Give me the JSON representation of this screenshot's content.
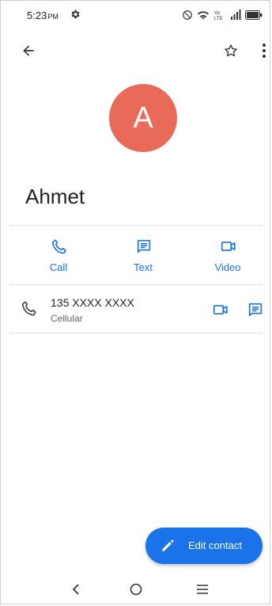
{
  "status_bar": {
    "time": "5:23",
    "ampm": "PM",
    "icons": [
      "settings-icon",
      "nfc-icon",
      "wifi-icon",
      "volte-icon",
      "signal-icon",
      "battery-icon"
    ]
  },
  "app_bar": {
    "back_icon": "arrow-left-icon",
    "favorite_icon": "star-outline-icon",
    "more_icon": "more-vert-icon"
  },
  "contact": {
    "avatar_letter": "A",
    "avatar_color": "#ea6a5a",
    "name": "Ahmet"
  },
  "actions": [
    {
      "label": "Call",
      "icon": "phone-icon"
    },
    {
      "label": "Text",
      "icon": "message-icon"
    },
    {
      "label": "Video",
      "icon": "video-icon"
    }
  ],
  "phone_entry": {
    "number": "135 XXXX XXXX",
    "type": "Cellular"
  },
  "fab": {
    "label": "Edit contact",
    "icon": "pencil-icon"
  },
  "colors": {
    "accent": "#1a73e8",
    "avatar": "#ea6a5a"
  },
  "nav": [
    "back-nav-icon",
    "home-nav-icon",
    "recents-nav-icon"
  ]
}
